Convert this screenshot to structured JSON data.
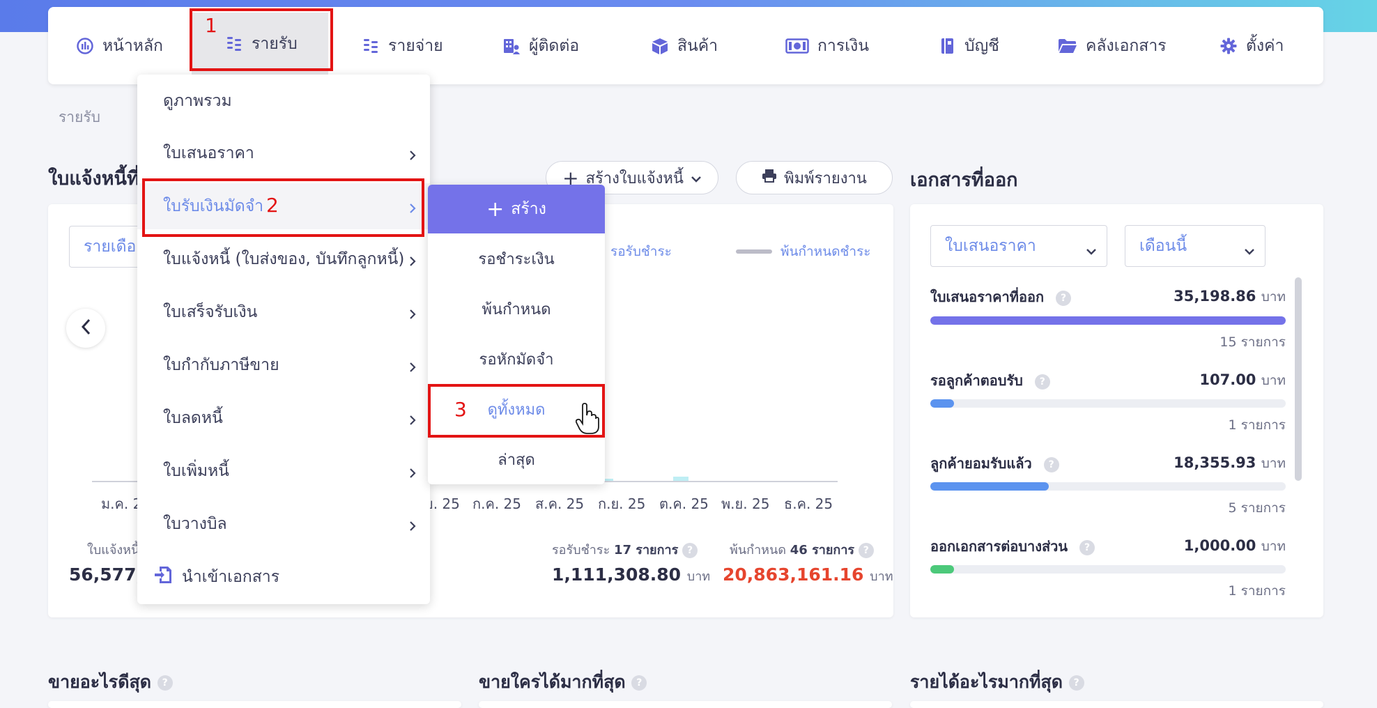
{
  "colors": {
    "accent": "#7472e9",
    "link": "#6d8be8",
    "red": "#e31414",
    "overdue": "#e6452e"
  },
  "nav": {
    "items": [
      {
        "label": "หน้าหลัก",
        "icon": "dashboard-icon"
      },
      {
        "label": "รายรับ",
        "icon": "coins-icon"
      },
      {
        "label": "รายจ่าย",
        "icon": "coins-icon"
      },
      {
        "label": "ผู้ติดต่อ",
        "icon": "contacts-icon"
      },
      {
        "label": "สินค้า",
        "icon": "box-icon"
      },
      {
        "label": "การเงิน",
        "icon": "money-icon"
      },
      {
        "label": "บัญชี",
        "icon": "book-icon"
      },
      {
        "label": "คลังเอกสาร",
        "icon": "folder-icon"
      },
      {
        "label": "ตั้งค่า",
        "icon": "gear-icon"
      }
    ]
  },
  "annotations": {
    "step1": "1",
    "step2": "2",
    "step3": "3"
  },
  "breadcrumb": "รายรับ",
  "invoice_section": {
    "title": "ใบแจ้งหนี้ที่รั",
    "create_button": "สร้างใบแจ้งหนี้",
    "print_button": "พิมพ์รายงาน",
    "period_select": "รายเดือ",
    "legend": [
      {
        "name": "รอรับชำระ",
        "color": "#bfeef4"
      },
      {
        "name": "พ้นกำหนดชำระ",
        "color": "#bcbcc8"
      }
    ],
    "ticks": [
      "ม.ค. 2",
      "ย. 25",
      "ก.ค. 25",
      "ส.ค. 25",
      "ก.ย. 25",
      "ต.ค. 25",
      "พ.ย. 25",
      "ธ.ค. 25"
    ],
    "stats": {
      "total_label": "ใบแจ้งหนี้",
      "total_value": "56,577,2",
      "pending_label": "รอรับชำระ",
      "pending_count": "17 รายการ",
      "pending_value": "1,111,308.80",
      "overdue_label": "พ้นกำหนด",
      "overdue_count": "46 รายการ",
      "overdue_value": "20,863,161.16",
      "currency": "บาท"
    }
  },
  "dropdown": {
    "items": [
      {
        "label": "ดูภาพรวม",
        "has_sub": false
      },
      {
        "label": "ใบเสนอราคา",
        "has_sub": true
      },
      {
        "label": "ใบรับเงินมัดจำ",
        "has_sub": true
      },
      {
        "label": "ใบแจ้งหนี้ (ใบส่งของ, บันทึกลูกหนี้)",
        "has_sub": true
      },
      {
        "label": "ใบเสร็จรับเงิน",
        "has_sub": true
      },
      {
        "label": "ใบกำกับภาษีขาย",
        "has_sub": true
      },
      {
        "label": "ใบลดหนี้",
        "has_sub": true
      },
      {
        "label": "ใบเพิ่มหนี้",
        "has_sub": true
      },
      {
        "label": "ใบวางบิล",
        "has_sub": true
      }
    ],
    "import_label": "นำเข้าเอกสาร"
  },
  "submenu": {
    "create_label": "สร้าง",
    "items": [
      "รอชำระเงิน",
      "พ้นกำหนด",
      "รอหักมัดจำ",
      "ดูทั้งหมด",
      "ล่าสุด"
    ]
  },
  "docs_section": {
    "title": "เอกสารที่ออก",
    "doc_type_select": "ใบเสนอราคา",
    "period_select": "เดือนนี้",
    "currency": "บาท",
    "rows": [
      {
        "title": "ใบเสนอราคาที่ออก",
        "amount": "35,198.86",
        "count": "15 รายการ",
        "progress": 1.0,
        "color": "#7472e9"
      },
      {
        "title": "รอลูกค้าตอบรับ",
        "amount": "107.00",
        "count": "1 รายการ",
        "progress": 0.066,
        "color": "#5b93ef"
      },
      {
        "title": "ลูกค้ายอมรับแล้ว",
        "amount": "18,355.93",
        "count": "5 รายการ",
        "progress": 0.333,
        "color": "#5b93ef"
      },
      {
        "title": "ออกเอกสารต่อบางส่วน",
        "amount": "1,000.00",
        "count": "1 รายการ",
        "progress": 0.066,
        "color": "#4cc97a"
      }
    ]
  },
  "bottom_titles": [
    "ขายอะไรดีสุด",
    "ขายใครได้มากที่สุด",
    "รายได้อะไรมากที่สุด"
  ]
}
